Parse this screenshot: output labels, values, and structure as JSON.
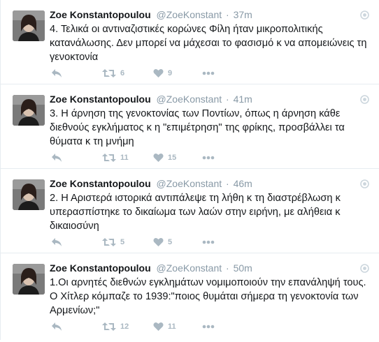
{
  "tweets": [
    {
      "name": "Zoe Konstantopoulou",
      "handle": "@ZoeKonstant",
      "separator": "·",
      "time": "37m",
      "text": "4. Τελικά οι αντιναζιστικές κορώνες Φίλη ήταν μικροπολιτικής κατανάλωσης. Δεν μπορεί να μάχεσαι το φασισμό κ να απομειώνεις τη γενοκτονία",
      "retweets": "6",
      "likes": "9"
    },
    {
      "name": "Zoe Konstantopoulou",
      "handle": "@ZoeKonstant",
      "separator": "·",
      "time": "41m",
      "text": "3. Η άρνηση της γενοκτονίας των Ποντίων, όπως η άρνηση κάθε διεθνούς εγκλήματος κ η \"επιμέτρηση\" της φρίκης, προσβάλλει τα θύματα κ τη μνήμη",
      "retweets": "11",
      "likes": "15"
    },
    {
      "name": "Zoe Konstantopoulou",
      "handle": "@ZoeKonstant",
      "separator": "·",
      "time": "46m",
      "text": "2. Η Αριστερά ιστορικά αντιπάλεψε τη λήθη κ τη διαστρέβλωση κ υπερασπίστηκε το δικαίωμα των λαών στην ειρήνη, με αλήθεια κ δικαιοσύνη",
      "retweets": "5",
      "likes": "5"
    },
    {
      "name": "Zoe Konstantopoulou",
      "handle": "@ZoeKonstant",
      "separator": "·",
      "time": "50m",
      "text": "1.Οι αρνητές διεθνών εγκλημάτων νομιμοποιούν την επανάληψή τους. Ο Χίτλερ κόμπαζε το 1939:\"ποιος θυμάται σήμερα τη γενοκτονία των Αρμενίων;\"",
      "retweets": "12",
      "likes": "11"
    }
  ],
  "icons": {
    "reply": "reply-icon",
    "retweet": "retweet-icon",
    "like": "heart-icon",
    "more": "more-dots-icon",
    "caret": "tweet-options-icon"
  },
  "colors": {
    "name": "#14171a",
    "meta": "#8899a6",
    "action": "#aab8c2",
    "divider": "#e6ecf0"
  }
}
